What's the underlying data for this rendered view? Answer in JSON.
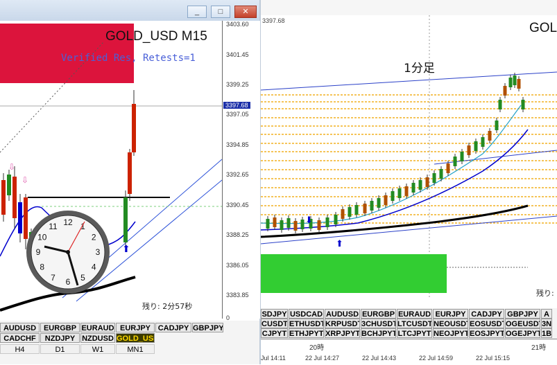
{
  "left_chart": {
    "title": "GOLD_USD M15",
    "zone_label": "Verified Res, Retests=1",
    "price_ticks": [
      "3403.60",
      "3401.45",
      "3399.25",
      "3397.05",
      "3394.85",
      "3392.65",
      "3390.45",
      "3388.25",
      "3386.05",
      "3383.85",
      "0"
    ],
    "current_price": "3397.68",
    "countdown": "残り: 2分57秒",
    "symbol_rows": [
      [
        "AUDUSD",
        "EURGBP",
        "EURAUD",
        "EURJPY",
        "CADJPY",
        "GBPJPY"
      ],
      [
        "CADCHF",
        "NZDJPY",
        "NZDUSD",
        "GOLD_USD"
      ],
      [
        "H4",
        "D1",
        "W1",
        "MN1"
      ]
    ],
    "window_buttons": {
      "minimize": "_",
      "restore": "□",
      "close": "✕"
    }
  },
  "right_chart": {
    "price_top": "3397.68",
    "title_partial": "GOLI",
    "annotation": "1分足",
    "countdown_partial": "残り:",
    "symbol_rows": [
      [
        "SDJPY",
        "USDCAD",
        "AUDUSD",
        "EURGBP",
        "EURAUD",
        "EURJPY",
        "CADJPY",
        "GBPJPY",
        "A"
      ],
      [
        "CUSDT",
        "ETHUSDT",
        "KRPUSDT",
        "3CHUSDT",
        "LTCUSDT",
        "NEOUSDT",
        "EOSUSDT",
        "OGEUSDT",
        "3N"
      ],
      [
        "CJPYT",
        "ETHJPYT",
        "XRPJPYT",
        "BCHJPYT",
        "LTCJPYT",
        "NEOJPYT",
        "EOSJPYT",
        "OGEJPYT",
        "1B"
      ]
    ],
    "time_markers": [
      "20時",
      "21時"
    ],
    "time_axis": [
      "Jul 14:11",
      "22 Jul 14:27",
      "22 Jul 14:43",
      "22 Jul 14:59",
      "22 Jul 15:15"
    ]
  },
  "clock": {
    "numerals": [
      "12",
      "1",
      "2",
      "3",
      "4",
      "5",
      "6",
      "7",
      "8",
      "9",
      "10",
      "11"
    ]
  },
  "colors": {
    "resistance_zone": "#dc143c",
    "support_zone": "#32cd32",
    "candle_up": "#228b22",
    "candle_down": "#cc2200",
    "ma_blue": "#0000cd",
    "ma_black": "#000000",
    "gold_button": "#ffd800"
  }
}
